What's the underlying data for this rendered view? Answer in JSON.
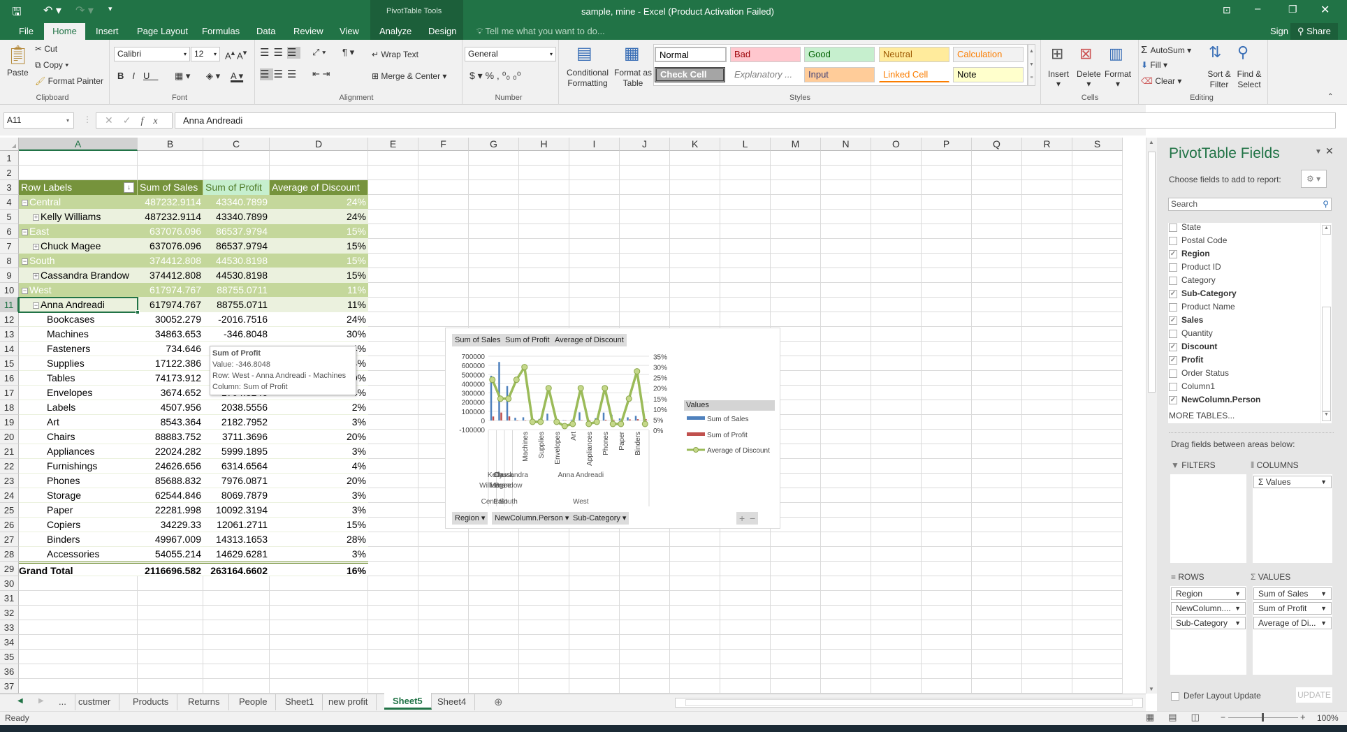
{
  "window": {
    "title": "sample, mine - Excel (Product Activation Failed)",
    "context_tab_group": "PivotTable Tools",
    "sign_in": "Sign in",
    "share": "Share"
  },
  "quick_access": {
    "save_icon": "save-icon",
    "undo_icon": "undo-icon",
    "redo_icon": "redo-icon"
  },
  "tabs": [
    {
      "label": "File"
    },
    {
      "label": "Home",
      "active": true
    },
    {
      "label": "Insert"
    },
    {
      "label": "Page Layout"
    },
    {
      "label": "Formulas"
    },
    {
      "label": "Data"
    },
    {
      "label": "Review"
    },
    {
      "label": "View"
    },
    {
      "label": "Analyze"
    },
    {
      "label": "Design"
    }
  ],
  "tell_me": "Tell me what you want to do...",
  "ribbon": {
    "clipboard": {
      "label": "Clipboard",
      "paste": "Paste",
      "cut": "Cut",
      "copy": "Copy",
      "format_painter": "Format Painter"
    },
    "font": {
      "label": "Font",
      "name": "Calibri",
      "size": "12"
    },
    "alignment": {
      "label": "Alignment",
      "wrap_text": "Wrap Text",
      "merge_center": "Merge & Center"
    },
    "number": {
      "label": "Number",
      "format": "General"
    },
    "styles": {
      "label": "Styles",
      "conditional_formatting": "Conditional Formatting",
      "format_as_table": "Format as Table",
      "gallery": [
        {
          "label": "Normal",
          "bg": "#ffffff",
          "fg": "#000000"
        },
        {
          "label": "Bad",
          "bg": "#ffc7ce",
          "fg": "#9c0006"
        },
        {
          "label": "Good",
          "bg": "#c6efce",
          "fg": "#006100"
        },
        {
          "label": "Neutral",
          "bg": "#ffeb9c",
          "fg": "#9c5700"
        },
        {
          "label": "Calculation",
          "bg": "#f2f2f2",
          "fg": "#fa7d00"
        },
        {
          "label": "Check Cell",
          "bg": "#a5a5a5",
          "fg": "#ffffff"
        },
        {
          "label": "Explanatory ...",
          "bg": "#ffffff",
          "fg": "#7f7f7f"
        },
        {
          "label": "Input",
          "bg": "#ffcc99",
          "fg": "#3f3f76"
        },
        {
          "label": "Linked Cell",
          "bg": "#ffffff",
          "fg": "#fa7d00"
        },
        {
          "label": "Note",
          "bg": "#ffffcc",
          "fg": "#000000"
        }
      ]
    },
    "cells": {
      "label": "Cells",
      "insert": "Insert",
      "delete": "Delete",
      "format": "Format"
    },
    "editing": {
      "label": "Editing",
      "autosum": "AutoSum",
      "fill": "Fill",
      "clear": "Clear",
      "sort_filter": "Sort & Filter",
      "find_select": "Find & Select"
    }
  },
  "formula_bar": {
    "name_box": "A11",
    "value": "Anna Andreadi"
  },
  "columns": [
    "A",
    "B",
    "C",
    "D",
    "E",
    "F",
    "G",
    "H",
    "I",
    "J",
    "K",
    "L",
    "M",
    "N",
    "O",
    "P",
    "Q",
    "R",
    "S"
  ],
  "row_count": 37,
  "selected_cell": "A11",
  "pivot": {
    "headers": [
      "Row Labels",
      "Sum of Sales",
      "Sum of Profit",
      "Average of Discount"
    ],
    "rows": [
      {
        "label": "Central",
        "level": "region",
        "toggle": "−",
        "sales": "487232.9114",
        "profit": "43340.7899",
        "discount": "24%"
      },
      {
        "label": "Kelly Williams",
        "level": "person",
        "toggle": "+",
        "sales": "487232.9114",
        "profit": "43340.7899",
        "discount": "24%"
      },
      {
        "label": "East",
        "level": "region",
        "toggle": "−",
        "sales": "637076.096",
        "profit": "86537.9794",
        "discount": "15%"
      },
      {
        "label": "Chuck Magee",
        "level": "person",
        "toggle": "+",
        "sales": "637076.096",
        "profit": "86537.9794",
        "discount": "15%"
      },
      {
        "label": "South",
        "level": "region",
        "toggle": "−",
        "sales": "374412.808",
        "profit": "44530.8198",
        "discount": "15%"
      },
      {
        "label": "Cassandra Brandow",
        "level": "person",
        "toggle": "+",
        "sales": "374412.808",
        "profit": "44530.8198",
        "discount": "15%"
      },
      {
        "label": "West",
        "level": "region",
        "toggle": "−",
        "sales": "617974.767",
        "profit": "88755.0711",
        "discount": "11%"
      },
      {
        "label": "Anna Andreadi",
        "level": "person",
        "toggle": "−",
        "sales": "617974.767",
        "profit": "88755.0711",
        "discount": "11%"
      },
      {
        "label": "Bookcases",
        "level": "sub",
        "sales": "30052.279",
        "profit": "-2016.7516",
        "discount": "24%"
      },
      {
        "label": "Machines",
        "level": "sub",
        "sales": "34863.653",
        "profit": "-346.8048",
        "discount": "30%"
      },
      {
        "label": "Fasteners",
        "level": "sub",
        "sales": "734.646",
        "profit": "",
        "discount": "4%"
      },
      {
        "label": "Supplies",
        "level": "sub",
        "sales": "17122.386",
        "profit": "",
        "discount": "4%"
      },
      {
        "label": "Tables",
        "level": "sub",
        "sales": "74173.912",
        "profit": "",
        "discount": "0%"
      },
      {
        "label": "Envelopes",
        "level": "sub",
        "sales": "3674.652",
        "profit": "1704.8246",
        "discount": "4%"
      },
      {
        "label": "Labels",
        "level": "sub",
        "sales": "4507.956",
        "profit": "2038.5556",
        "discount": "2%"
      },
      {
        "label": "Art",
        "level": "sub",
        "sales": "8543.364",
        "profit": "2182.7952",
        "discount": "3%"
      },
      {
        "label": "Chairs",
        "level": "sub",
        "sales": "88883.752",
        "profit": "3711.3696",
        "discount": "20%"
      },
      {
        "label": "Appliances",
        "level": "sub",
        "sales": "22024.282",
        "profit": "5999.1895",
        "discount": "3%"
      },
      {
        "label": "Furnishings",
        "level": "sub",
        "sales": "24626.656",
        "profit": "6314.6564",
        "discount": "4%"
      },
      {
        "label": "Phones",
        "level": "sub",
        "sales": "85688.832",
        "profit": "7976.0871",
        "discount": "20%"
      },
      {
        "label": "Storage",
        "level": "sub",
        "sales": "62544.846",
        "profit": "8069.7879",
        "discount": "3%"
      },
      {
        "label": "Paper",
        "level": "sub",
        "sales": "22281.998",
        "profit": "10092.3194",
        "discount": "3%"
      },
      {
        "label": "Copiers",
        "level": "sub",
        "sales": "34229.33",
        "profit": "12061.2711",
        "discount": "15%"
      },
      {
        "label": "Binders",
        "level": "sub",
        "sales": "49967.009",
        "profit": "14313.1653",
        "discount": "28%"
      },
      {
        "label": "Accessories",
        "level": "sub",
        "sales": "54055.214",
        "profit": "14629.6281",
        "discount": "3%"
      },
      {
        "label": "Grand Total",
        "level": "total",
        "sales": "2116696.582",
        "profit": "263164.6602",
        "discount": "16%"
      }
    ]
  },
  "tooltip": {
    "title": "Sum of Profit",
    "value": "Value: -346.8048",
    "row": "Row: West - Anna Andreadi - Machines",
    "column": "Column: Sum of Profit"
  },
  "chart_data": {
    "type": "bar+line",
    "field_buttons_top": [
      "Sum of Sales",
      "Sum of Profit",
      "Average of Discount"
    ],
    "field_buttons_bottom": [
      "Region",
      "NewColumn.Person",
      "Sub-Category"
    ],
    "categories": [
      {
        "region": "Central",
        "person": "Kelly Williams",
        "sub": ""
      },
      {
        "region": "East",
        "person": "Chuck Magee",
        "sub": ""
      },
      {
        "region": "South",
        "person": "Cassandra Brandow",
        "sub": ""
      },
      {
        "region": "West",
        "person": "Anna Andreadi",
        "sub": "Bookcases"
      },
      {
        "region": "West",
        "person": "Anna Andreadi",
        "sub": "Machines"
      },
      {
        "region": "West",
        "person": "Anna Andreadi",
        "sub": "Fasteners"
      },
      {
        "region": "West",
        "person": "Anna Andreadi",
        "sub": "Supplies"
      },
      {
        "region": "West",
        "person": "Anna Andreadi",
        "sub": "Tables"
      },
      {
        "region": "West",
        "person": "Anna Andreadi",
        "sub": "Envelopes"
      },
      {
        "region": "West",
        "person": "Anna Andreadi",
        "sub": "Labels"
      },
      {
        "region": "West",
        "person": "Anna Andreadi",
        "sub": "Art"
      },
      {
        "region": "West",
        "person": "Anna Andreadi",
        "sub": "Chairs"
      },
      {
        "region": "West",
        "person": "Anna Andreadi",
        "sub": "Appliances"
      },
      {
        "region": "West",
        "person": "Anna Andreadi",
        "sub": "Furnishings"
      },
      {
        "region": "West",
        "person": "Anna Andreadi",
        "sub": "Phones"
      },
      {
        "region": "West",
        "person": "Anna Andreadi",
        "sub": "Storage"
      },
      {
        "region": "West",
        "person": "Anna Andreadi",
        "sub": "Paper"
      },
      {
        "region": "West",
        "person": "Anna Andreadi",
        "sub": "Copiers"
      },
      {
        "region": "West",
        "person": "Anna Andreadi",
        "sub": "Binders"
      },
      {
        "region": "West",
        "person": "Anna Andreadi",
        "sub": "Accessories"
      }
    ],
    "series": [
      {
        "name": "Sum of Sales",
        "axis": "primary",
        "kind": "bar",
        "color": "#4f81bd",
        "values": [
          487232.9114,
          637076.096,
          374412.808,
          30052.279,
          34863.653,
          734.646,
          17122.386,
          74173.912,
          3674.652,
          4507.956,
          8543.364,
          88883.752,
          22024.282,
          24626.656,
          85688.832,
          62544.846,
          22281.998,
          34229.33,
          49967.009,
          54055.214
        ]
      },
      {
        "name": "Sum of Profit",
        "axis": "primary",
        "kind": "bar",
        "color": "#c0504d",
        "values": [
          43340.7899,
          86537.9794,
          44530.8198,
          -2016.7516,
          -346.8048,
          null,
          null,
          null,
          1704.8246,
          2038.5556,
          2182.7952,
          3711.3696,
          5999.1895,
          6314.6564,
          7976.0871,
          8069.7879,
          10092.3194,
          12061.2711,
          14313.1653,
          14629.6281
        ]
      },
      {
        "name": "Average of Discount",
        "axis": "secondary",
        "kind": "line",
        "color": "#9bbb59",
        "values": [
          24,
          15,
          15,
          24,
          30,
          4,
          4,
          20,
          4,
          2,
          3,
          20,
          3,
          4,
          20,
          3,
          3,
          15,
          28,
          3
        ]
      }
    ],
    "y_primary": {
      "min": -100000,
      "max": 700000,
      "step": 100000,
      "ticks": [
        "700000",
        "600000",
        "500000",
        "400000",
        "300000",
        "200000",
        "100000",
        "0",
        "-100000"
      ]
    },
    "y_secondary": {
      "min": 0,
      "max": 35,
      "step": 5,
      "ticks": [
        "35%",
        "30%",
        "25%",
        "20%",
        "15%",
        "10%",
        "5%",
        "0%"
      ]
    },
    "grid": true,
    "legend": {
      "title": "Values",
      "position": "right",
      "entries": [
        "Sum of Sales",
        "Sum of Profit",
        "Average of Discount"
      ]
    }
  },
  "pane": {
    "title": "PivotTable Fields",
    "choose": "Choose fields to add to report:",
    "search_placeholder": "Search",
    "fields": [
      {
        "label": "State",
        "checked": false
      },
      {
        "label": "Postal Code",
        "checked": false
      },
      {
        "label": "Region",
        "checked": true
      },
      {
        "label": "Product ID",
        "checked": false
      },
      {
        "label": "Category",
        "checked": false
      },
      {
        "label": "Sub-Category",
        "checked": true
      },
      {
        "label": "Product Name",
        "checked": false
      },
      {
        "label": "Sales",
        "checked": true
      },
      {
        "label": "Quantity",
        "checked": false
      },
      {
        "label": "Discount",
        "checked": true
      },
      {
        "label": "Profit",
        "checked": true
      },
      {
        "label": "Order Status",
        "checked": false
      },
      {
        "label": "Column1",
        "checked": false
      },
      {
        "label": "NewColumn.Person",
        "checked": true
      }
    ],
    "more_tables": "MORE TABLES...",
    "drag_hint": "Drag fields between areas below:",
    "filters": {
      "label": "FILTERS",
      "items": []
    },
    "columns": {
      "label": "COLUMNS",
      "items": [
        "Σ  Values"
      ]
    },
    "rows": {
      "label": "ROWS",
      "items": [
        "Region",
        "NewColumn....",
        "Sub-Category"
      ]
    },
    "values": {
      "label": "VALUES",
      "items": [
        "Sum of Sales",
        "Sum of Profit",
        "Average of Di..."
      ]
    },
    "defer": "Defer Layout Update",
    "update": "UPDATE"
  },
  "sheet_tabs": {
    "ellipsis": "...",
    "tabs": [
      "custmer",
      "Products",
      "Returns",
      "People",
      "Sheet1",
      "new profit",
      "Sheet5",
      "Sheet4"
    ],
    "active": "Sheet5"
  },
  "status": {
    "ready": "Ready",
    "zoom": "100%"
  },
  "colors": {
    "excel_green": "#217346",
    "pivot_header": "#76933c",
    "region_row": "#c4d79b",
    "person_row": "#ebf1de"
  }
}
